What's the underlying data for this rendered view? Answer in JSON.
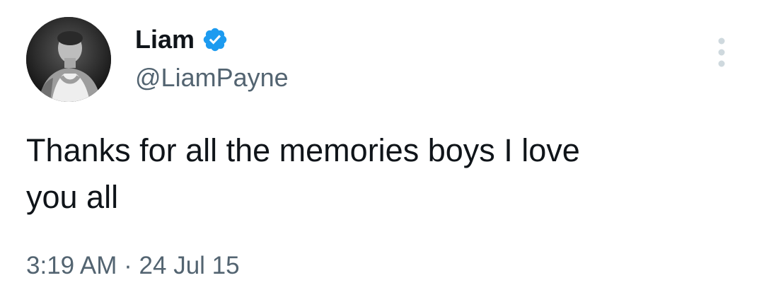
{
  "tweet": {
    "display_name": "Liam",
    "handle": "@LiamPayne",
    "verified": true,
    "text": "Thanks for all the memories boys I love\nyou all",
    "time": "3:19 AM",
    "separator": "·",
    "date": "24 Jul 15"
  },
  "colors": {
    "verified_badge": "#1d9bf0",
    "secondary_text": "#536471",
    "primary_text": "#0f1419"
  },
  "icons": {
    "avatar": "profile-photo",
    "verified": "verified-badge-icon",
    "more": "more-options-icon"
  }
}
